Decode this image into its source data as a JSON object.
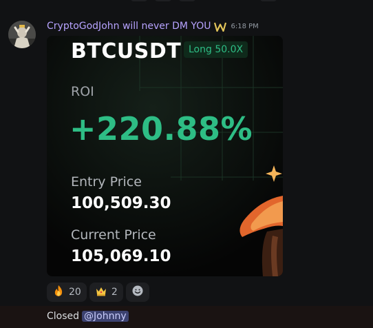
{
  "message": {
    "username": "CryptoGodJohn will never DM YOU",
    "timestamp": "6:18 PM",
    "user_badge": "w-logo-icon",
    "avatar": "user-avatar"
  },
  "card": {
    "pair": "BTCUSDT",
    "position": "Long 50.0X",
    "roi_label": "ROI",
    "roi_value": "+220.88%",
    "entry_label": "Entry Price",
    "entry_value": "100,509.30",
    "current_label": "Current Price",
    "current_value": "105,069.10",
    "accent_color": "#2ebd85"
  },
  "reactions": [
    {
      "icon": "fire-emoji",
      "count": "20"
    },
    {
      "icon": "crown-emoji",
      "count": "2"
    },
    {
      "icon": "add-reaction-icon"
    }
  ],
  "next_message": {
    "text": "Closed",
    "mention": "@Johnny"
  }
}
